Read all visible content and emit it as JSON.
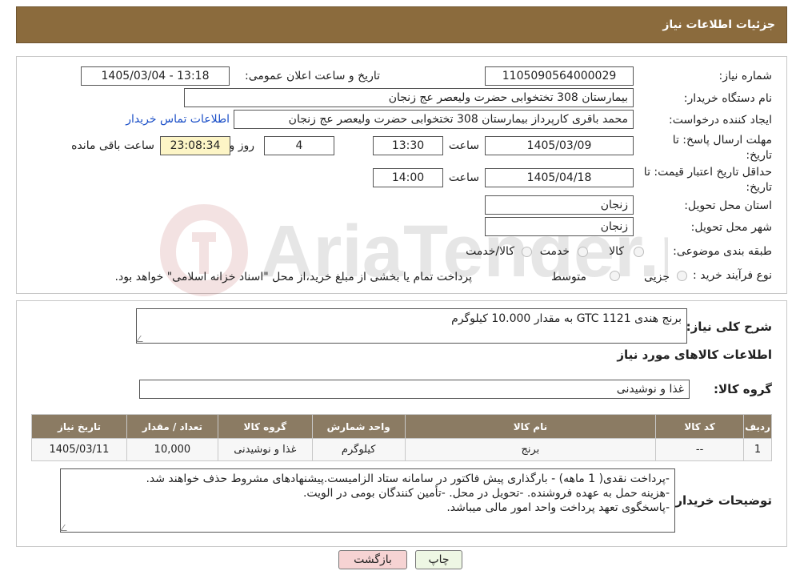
{
  "header": {
    "title": "جزئیات اطلاعات نیاز"
  },
  "form": {
    "need_number_label": "شماره نیاز:",
    "need_number": "1105090564000029",
    "announce_label": "تاریخ و ساعت اعلان عمومی:",
    "announce_value": "1405/03/04 - 13:18",
    "buyer_org_label": "نام دستگاه خریدار:",
    "buyer_org": "بیمارستان 308 تختخوابی حضرت ولیعصر عج  زنجان",
    "requester_label": "ایجاد کننده درخواست:",
    "requester": "محمد باقری کارپرداز بیمارستان 308 تختخوابی حضرت ولیعصر عج  زنجان",
    "contact_link": "اطلاعات تماس خریدار",
    "reply_deadline_label": "مهلت ارسال پاسخ: تا تاریخ:",
    "reply_date": "1405/03/09",
    "time_label": "ساعت",
    "reply_time": "13:30",
    "days_value": "4",
    "days_label": "روز و",
    "remaining_value": "23:08:34",
    "remaining_label": "ساعت باقی مانده",
    "validity_label": "حداقل تاریخ اعتبار قیمت: تا تاریخ:",
    "validity_date": "1405/04/18",
    "validity_time": "14:00",
    "province_label": "استان محل تحویل:",
    "province": "زنجان",
    "city_label": "شهر محل تحویل:",
    "city": "زنجان",
    "category_label": "طبقه بندی موضوعی:",
    "category_options": [
      "کالا",
      "خدمت",
      "کالا/خدمت"
    ],
    "process_label": "نوع فرآیند خرید :",
    "process_options": [
      "جزیی",
      "متوسط"
    ],
    "process_note": "پرداخت تمام یا بخشی از مبلغ خرید،از محل \"اسناد خزانه اسلامی\" خواهد بود."
  },
  "details": {
    "summary_label": "شرح کلی نیاز:",
    "summary": "برنج هندی GTC 1121 به مقدار 10.000 کیلوگرم",
    "goods_info_title": "اطلاعات کالاهای مورد نیاز",
    "goods_group_label": "گروه کالا:",
    "goods_group": "غذا و نوشیدنی"
  },
  "table": {
    "headers": [
      "ردیف",
      "کد کالا",
      "نام کالا",
      "واحد شمارش",
      "گروه کالا",
      "تعداد / مقدار",
      "تاریخ نیاز"
    ],
    "rows": [
      [
        "1",
        "--",
        "برنج",
        "کیلوگرم",
        "غذا و نوشیدنی",
        "10,000",
        "1405/03/11"
      ]
    ]
  },
  "notes": {
    "label": "توضیحات خریدار:",
    "lines": [
      "-پرداخت  نقدی( 1 ماهه) - بارگذاری پیش فاکتور در سامانه ستاد الزامیست.پیشنهادهای مشروط حذف خواهند شد.",
      "-هزینه حمل به عهده فروشنده. -تحویل در محل. -تأمین کنندگان بومی در الویت.",
      "-پاسخگوی تعهد پرداخت واحد امور مالی میباشد."
    ]
  },
  "buttons": {
    "print": "چاپ",
    "back": "بازگشت"
  },
  "watermark": {
    "text": "AriaTender.neT"
  },
  "colors": {
    "header": "#8b6b3d",
    "table_header": "#8b7b63",
    "link": "#1a4ec7",
    "back_button": "#f6d3d3",
    "print_button": "#eef7e4"
  }
}
